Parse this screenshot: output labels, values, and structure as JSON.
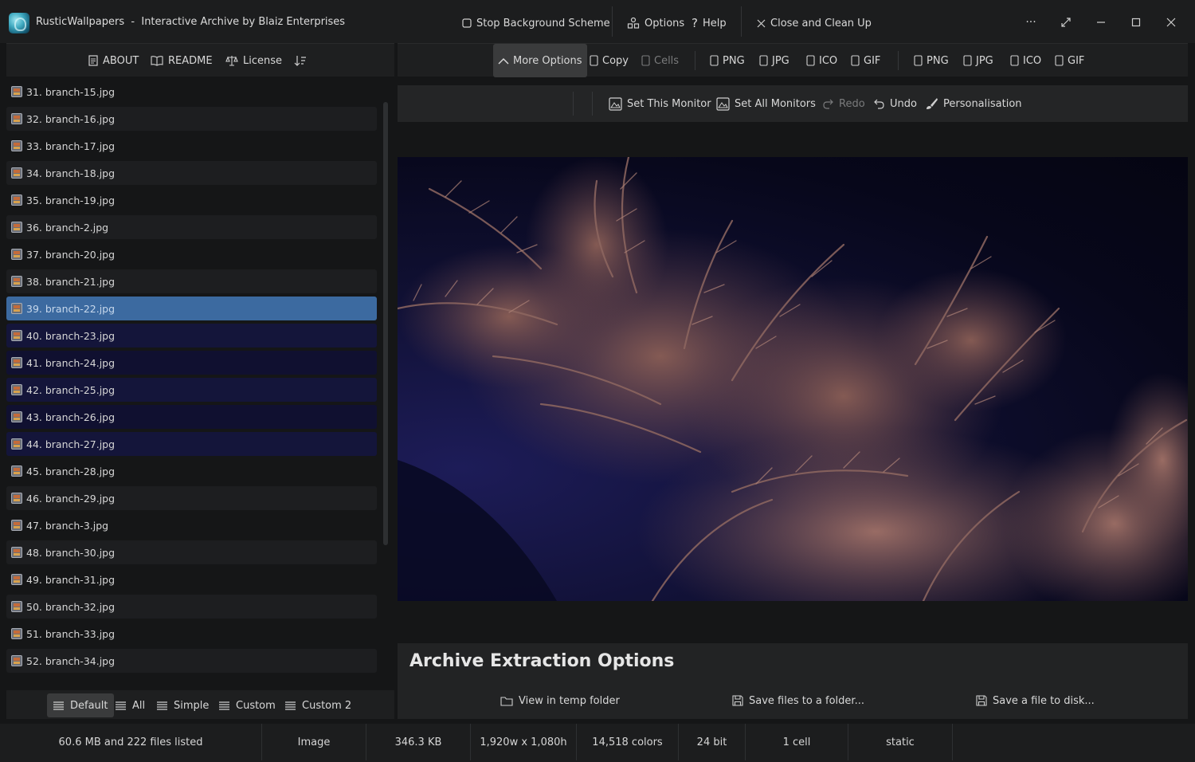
{
  "titlebar": {
    "app_name": "RusticWallpapers",
    "separator": "-",
    "subtitle": "Interactive Archive by Blaiz Enterprises",
    "stop_label": "Stop Background Scheme",
    "options_label": "Options",
    "help_label": "Help",
    "close_label": "Close and Clean Up",
    "more_glyph": "···"
  },
  "left_toolbar": {
    "about": "ABOUT",
    "readme": "README",
    "license": "License"
  },
  "files": [
    "31. branch-15.jpg",
    "32. branch-16.jpg",
    "33. branch-17.jpg",
    "34. branch-18.jpg",
    "35. branch-19.jpg",
    "36. branch-2.jpg",
    "37. branch-20.jpg",
    "38. branch-21.jpg",
    "39. branch-22.jpg",
    "40. branch-23.jpg",
    "41. branch-24.jpg",
    "42. branch-25.jpg",
    "43. branch-26.jpg",
    "44. branch-27.jpg",
    "45. branch-28.jpg",
    "46. branch-29.jpg",
    "47. branch-3.jpg",
    "48. branch-30.jpg",
    "49. branch-31.jpg",
    "50. branch-32.jpg",
    "51. branch-33.jpg",
    "52. branch-34.jpg"
  ],
  "selected_file_index": 8,
  "view_modes": {
    "default": "Default",
    "all": "All",
    "simple": "Simple",
    "custom": "Custom",
    "custom2": "Custom 2"
  },
  "right_toolbar": {
    "more_options": "More Options",
    "copy": "Copy",
    "cells": "Cells",
    "group1": [
      "PNG",
      "JPG",
      "ICO",
      "GIF"
    ],
    "group2": [
      "PNG",
      "JPG",
      "ICO",
      "GIF"
    ]
  },
  "sub_toolbar": {
    "set_this_monitor": "Set This Monitor",
    "set_all_monitors": "Set All Monitors",
    "redo": "Redo",
    "undo": "Undo",
    "personalisation": "Personalisation"
  },
  "extraction": {
    "title": "Archive Extraction Options",
    "view_temp": "View in temp folder",
    "save_folder": "Save files to a folder...",
    "save_file": "Save a file to disk..."
  },
  "status": {
    "summary": "60.6 MB and 222 files listed",
    "type": "Image",
    "size": "346.3 KB",
    "dimensions": "1,920w x 1,080h",
    "colors": "14,518 colors",
    "depth": "24 bit",
    "cells": "1 cell",
    "mode": "static"
  },
  "colors": {
    "selection": "#3c6aa0",
    "background": "#151617",
    "panel": "#1e1f20"
  }
}
